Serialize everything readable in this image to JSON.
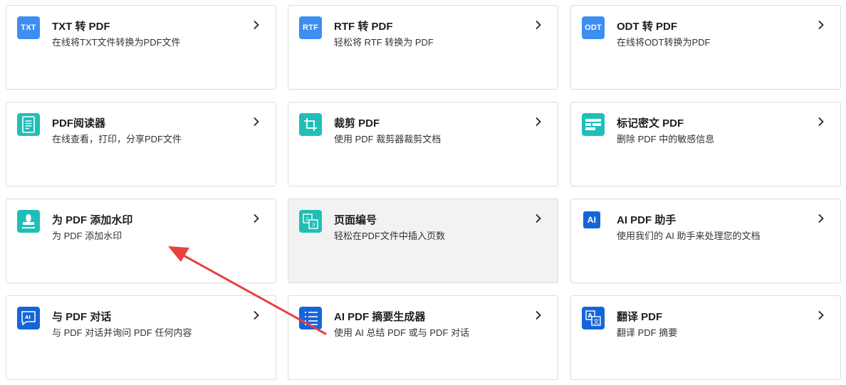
{
  "colors": {
    "blue_light": "#3d8ef0",
    "teal": "#1fbfb8",
    "navy": "#1565d8",
    "annotation_arrow": "#e8413f"
  },
  "cards": [
    {
      "title": "TXT 转 PDF",
      "desc": "在线将TXT文件转换为PDF文件",
      "icon": "txt-icon",
      "icon_text": "TXT"
    },
    {
      "title": "RTF 转 PDF",
      "desc": "轻松将 RTF 转换为 PDF",
      "icon": "rtf-icon",
      "icon_text": "RTF"
    },
    {
      "title": "ODT 转 PDF",
      "desc": "在线将ODT转换为PDF",
      "icon": "odt-icon",
      "icon_text": "ODT"
    },
    {
      "title": "PDF阅读器",
      "desc": "在线查看，打印，分享PDF文件",
      "icon": "document-icon"
    },
    {
      "title": "裁剪 PDF",
      "desc": "使用 PDF 裁剪器裁剪文档",
      "icon": "crop-icon"
    },
    {
      "title": "标记密文 PDF",
      "desc": "删除 PDF 中的敏感信息",
      "icon": "redact-icon"
    },
    {
      "title": "为 PDF 添加水印",
      "desc": "为 PDF 添加水印",
      "icon": "stamp-icon"
    },
    {
      "title": "页面编号",
      "desc": "轻松在PDF文件中插入页数",
      "icon": "page-number-icon"
    },
    {
      "title": "AI PDF 助手",
      "desc": "使用我们的 AI 助手来处理您的文档",
      "icon": "ai-icon",
      "icon_text": "AI"
    },
    {
      "title": "与 PDF 对话",
      "desc": "与 PDF 对话并询问 PDF 任何内容",
      "icon": "chat-ai-icon",
      "icon_text": "AI"
    },
    {
      "title": "AI PDF 摘要生成器",
      "desc": "使用 AI 总结 PDF 或与 PDF 对话",
      "icon": "list-icon"
    },
    {
      "title": "翻译 PDF",
      "desc": "翻译 PDF 摘要",
      "icon": "translate-icon"
    }
  ]
}
